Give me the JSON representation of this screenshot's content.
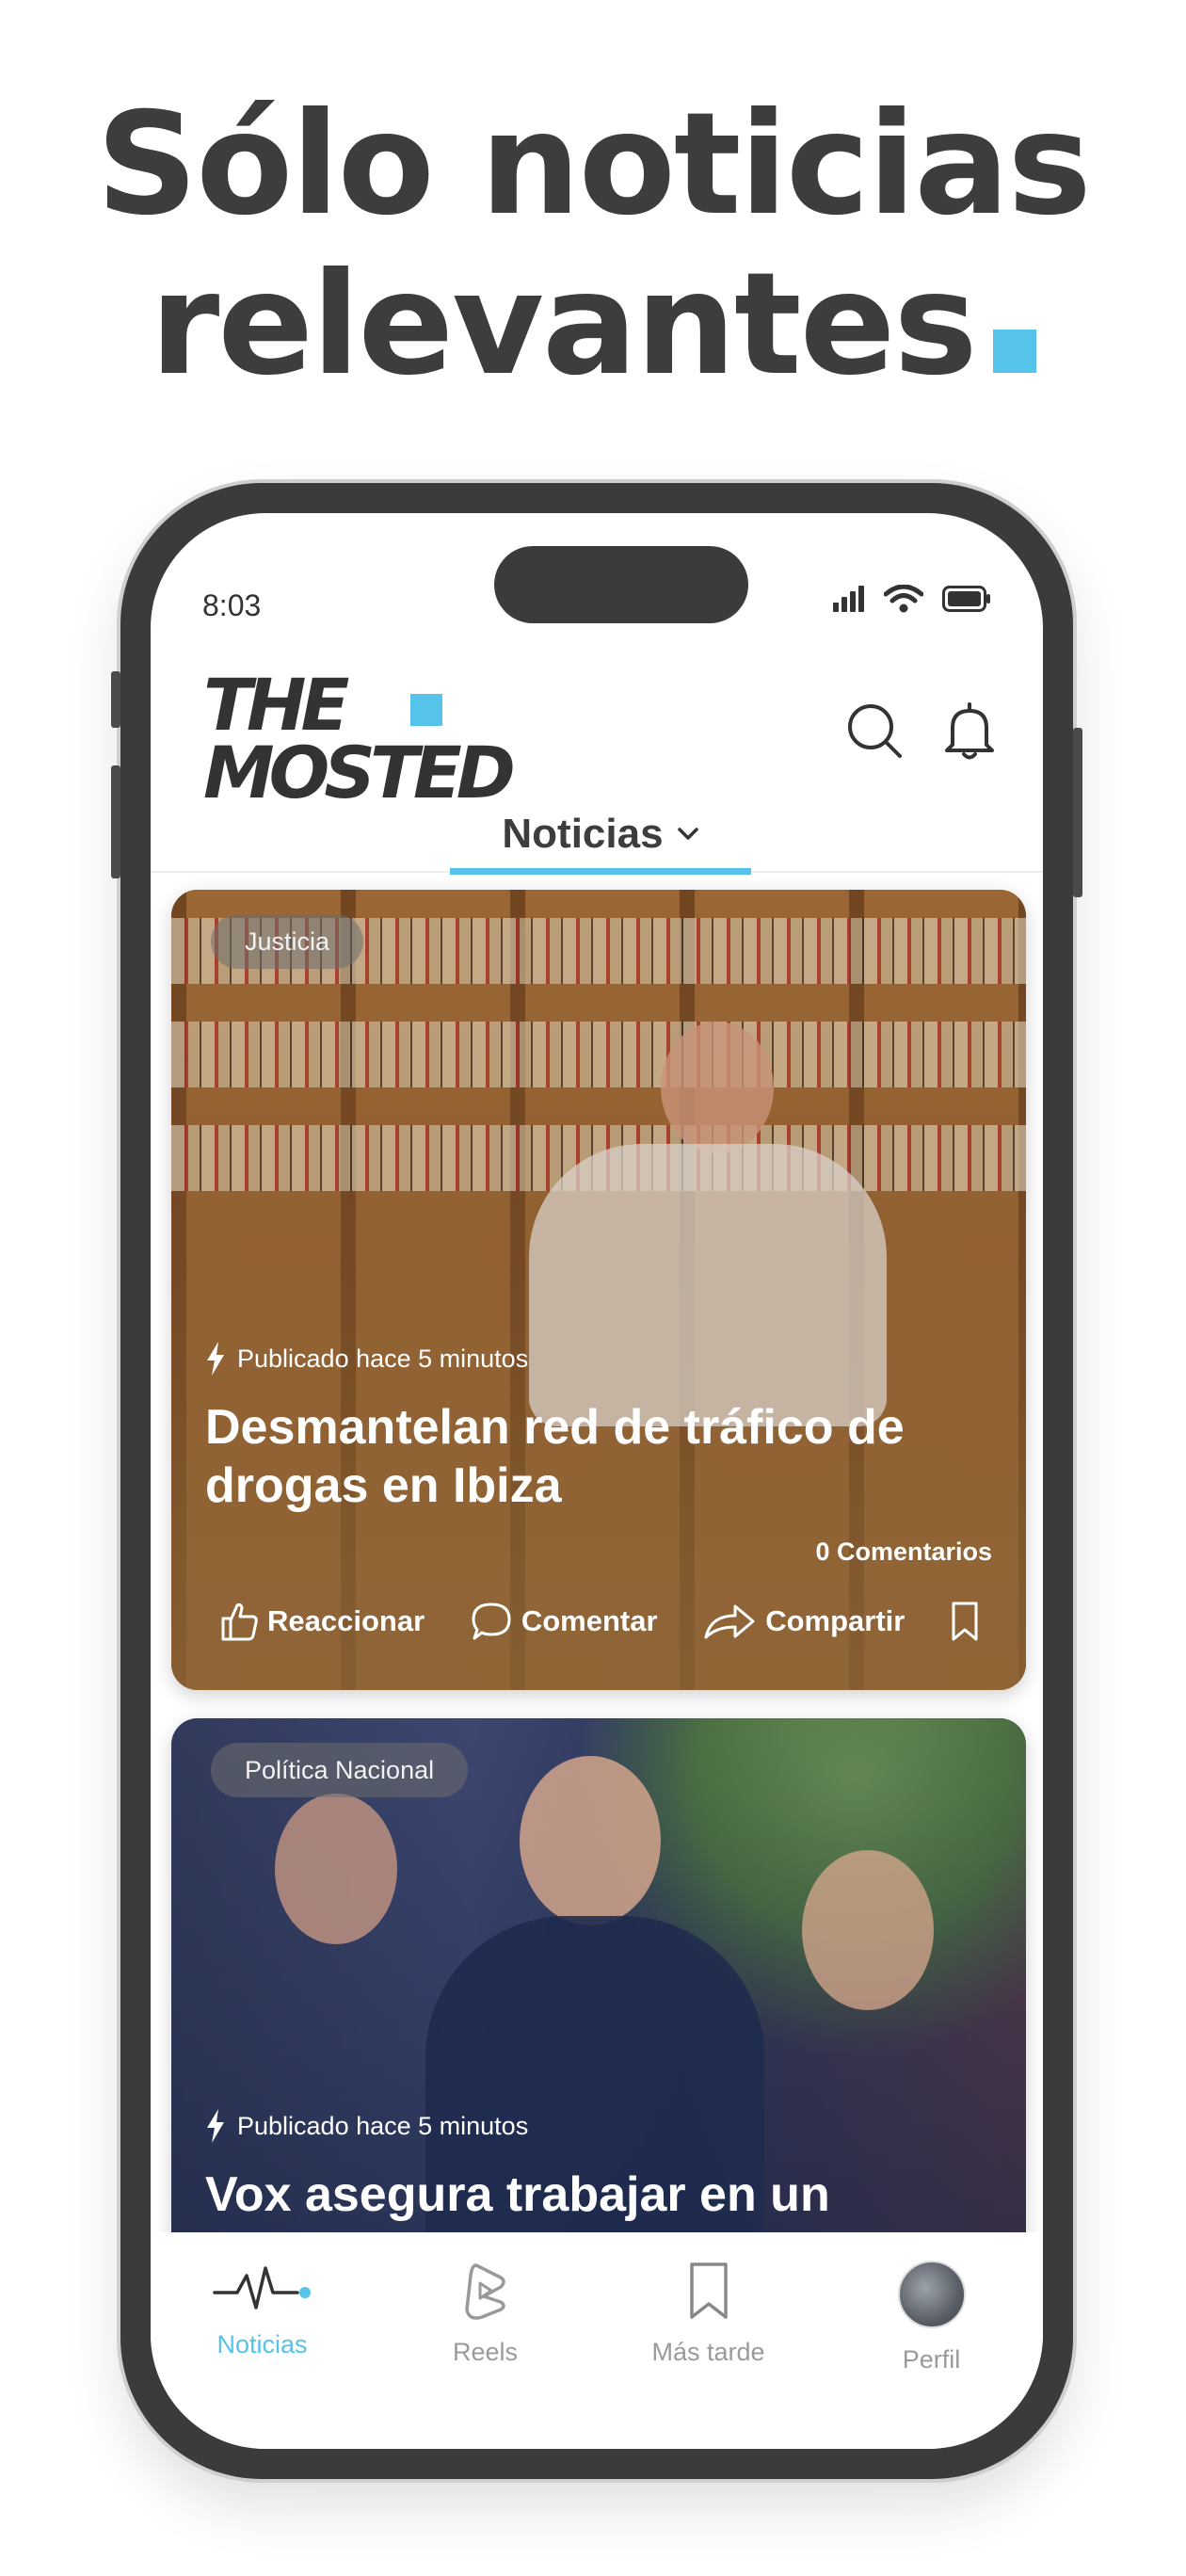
{
  "headline": {
    "line1": "Sólo noticias",
    "line2": "relevantes"
  },
  "colors": {
    "accent": "#55c3ea",
    "text": "#3d3d3d"
  },
  "status_bar": {
    "time": "8:03",
    "icons": [
      "signal-icon",
      "wifi-icon",
      "battery-icon"
    ]
  },
  "app": {
    "logo_line1": "THE",
    "logo_line2": "MOSTED",
    "header_icons": [
      "search-icon",
      "bell-icon"
    ]
  },
  "feed_tab": {
    "label": "Noticias"
  },
  "articles": [
    {
      "category": "Justicia",
      "published": "Publicado hace 5 minutos",
      "title": "Desmantelan red de tráfico de drogas en Ibiza",
      "comments": "0 Comentarios",
      "actions": {
        "react": "Reaccionar",
        "comment": "Comentar",
        "share": "Compartir"
      }
    },
    {
      "category": "Política Nacional",
      "published": "Publicado hace 5 minutos",
      "title": "Vox asegura trabajar en un acuerdo para la reelección de"
    }
  ],
  "bottom_nav": [
    {
      "label": "Noticias",
      "icon": "pulse-icon",
      "active": true
    },
    {
      "label": "Reels",
      "icon": "reels-icon",
      "active": false
    },
    {
      "label": "Más tarde",
      "icon": "bookmark-icon",
      "active": false
    },
    {
      "label": "Perfil",
      "icon": "avatar",
      "active": false
    }
  ]
}
